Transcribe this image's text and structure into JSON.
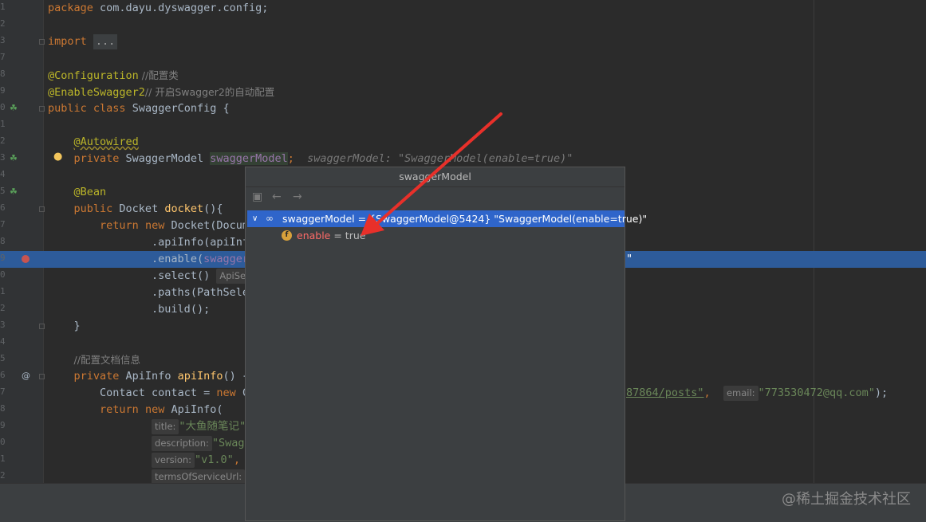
{
  "editor": {
    "lines": {
      "l1": {
        "num": "1",
        "kw": "package",
        "text": " com.dayu.dyswagger.config;"
      },
      "l2": {
        "num": "2"
      },
      "l3": {
        "num": "3",
        "kw": "import",
        "fold": "..."
      },
      "l4": {
        "num": "7"
      },
      "l5": {
        "num": "8",
        "ann": "@Configuration",
        "comment": " //配置类"
      },
      "l6": {
        "num": "9",
        "ann": "@EnableSwagger2",
        "comment": "// 开启Swagger2的自动配置"
      },
      "l7": {
        "num": "0",
        "kw1": "public",
        "kw2": "class",
        "name": " SwaggerConfig {"
      },
      "l8": {
        "num": "1"
      },
      "l9": {
        "num": "2",
        "ann": "@Autowired"
      },
      "l10": {
        "num": "3",
        "kw": "private",
        "type": " SwaggerModel ",
        "field": "swaggerModel",
        "semi": ";",
        "inlay": "swaggerModel: \"SwaggerModel(enable=true)\""
      },
      "l11": {
        "num": "4"
      },
      "l12": {
        "num": "5",
        "ann": "@Bean"
      },
      "l13": {
        "num": "6",
        "kw": "public",
        "type": " Docket ",
        "fn": "docket",
        "rest": "(){"
      },
      "l14": {
        "num": "7",
        "kw1": "return",
        "kw2": "new",
        "rest": " Docket(Docum"
      },
      "l15": {
        "num": "8",
        "text": ".apiInfo(apiInf"
      },
      "l16": {
        "num": "9",
        "text": ".enable(",
        "field": "swagger",
        "tail": "\""
      },
      "l17": {
        "num": "0",
        "text": ".select()",
        "hint": "ApiSele"
      },
      "l18": {
        "num": "1",
        "text": ".paths(PathSele"
      },
      "l19": {
        "num": "2",
        "text": ".build();"
      },
      "l20": {
        "num": "3",
        "text": "}"
      },
      "l21": {
        "num": "4"
      },
      "l22": {
        "num": "5",
        "comment": "//配置文档信息"
      },
      "l23": {
        "num": "6",
        "kw": "private",
        "type": " ApiInfo ",
        "fn": "apiInfo",
        "rest": "() {"
      },
      "l24": {
        "num": "7",
        "text": "Contact contact = ",
        "kw": "new",
        "rest": " C",
        "str1": "87864/posts\"",
        "comma": ",",
        "hint": "email:",
        "str2": "\"773530472@qq.com\"",
        "end": ");"
      },
      "l25": {
        "num": "8",
        "kw1": "return",
        "kw2": "new",
        "rest": " ApiInfo("
      },
      "l26": {
        "num": "9",
        "hint": "title:",
        "str": "\"大鱼随笔记\""
      },
      "l27": {
        "num": "0",
        "hint": "description:",
        "str": "\"Swag"
      },
      "l28": {
        "num": "1",
        "hint": "version:",
        "str": "\"v1.0\"",
        "tail": ","
      },
      "l29": {
        "num": "2",
        "hint": "termsOfServiceUrl:"
      }
    }
  },
  "popup": {
    "title": "swaggerModel",
    "tree": [
      {
        "label": "swaggerModel = {SwaggerModel@5424} \"SwaggerModel(enable=true)\""
      },
      {
        "name": "enable",
        "value": " = true",
        "badge": "f"
      }
    ]
  },
  "watermark": "@稀土掘金技术社区",
  "colors": {
    "selection": "#2f65ca",
    "highlight": "#2d5b9a",
    "arrow": "#e8302a"
  }
}
